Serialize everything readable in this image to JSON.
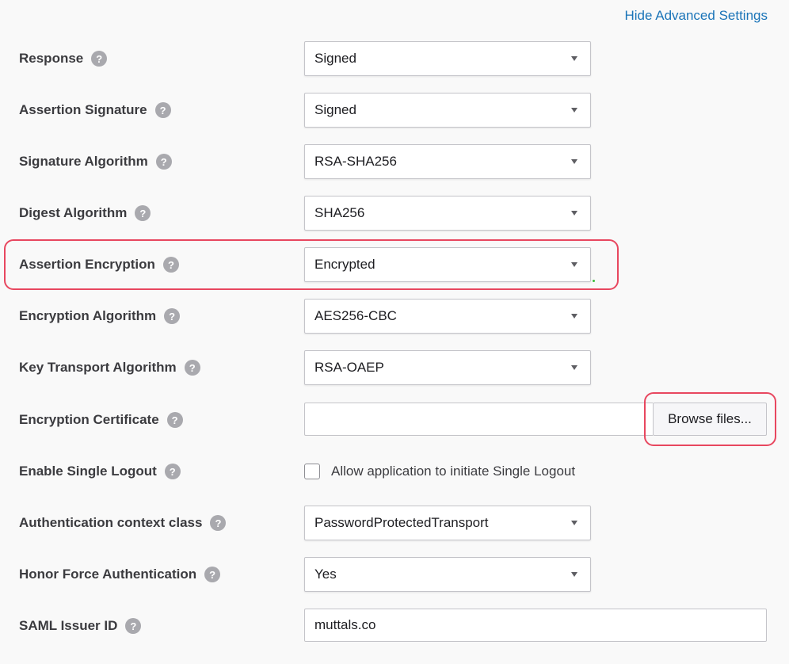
{
  "header": {
    "hide_advanced_label": "Hide Advanced Settings"
  },
  "help_glyph": "?",
  "fields": {
    "response": {
      "label": "Response",
      "value": "Signed"
    },
    "assertion_signature": {
      "label": "Assertion Signature",
      "value": "Signed"
    },
    "signature_algorithm": {
      "label": "Signature Algorithm",
      "value": "RSA-SHA256"
    },
    "digest_algorithm": {
      "label": "Digest Algorithm",
      "value": "SHA256"
    },
    "assertion_encryption": {
      "label": "Assertion Encryption",
      "value": "Encrypted"
    },
    "encryption_algorithm": {
      "label": "Encryption Algorithm",
      "value": "AES256-CBC"
    },
    "key_transport_algorithm": {
      "label": "Key Transport Algorithm",
      "value": "RSA-OAEP"
    },
    "encryption_certificate": {
      "label": "Encryption Certificate",
      "value": "",
      "browse_label": "Browse files..."
    },
    "enable_single_logout": {
      "label": "Enable Single Logout",
      "checkbox_label": "Allow application to initiate Single Logout",
      "checked": false
    },
    "authentication_context_class": {
      "label": "Authentication context class",
      "value": "PasswordProtectedTransport"
    },
    "honor_force_authentication": {
      "label": "Honor Force Authentication",
      "value": "Yes"
    },
    "saml_issuer_id": {
      "label": "SAML Issuer ID",
      "value": "muttals.co"
    }
  },
  "colors": {
    "link": "#1a74b8",
    "highlight": "#e8475f",
    "help_icon": "#a9a9ae",
    "background": "#f9f9f9"
  }
}
